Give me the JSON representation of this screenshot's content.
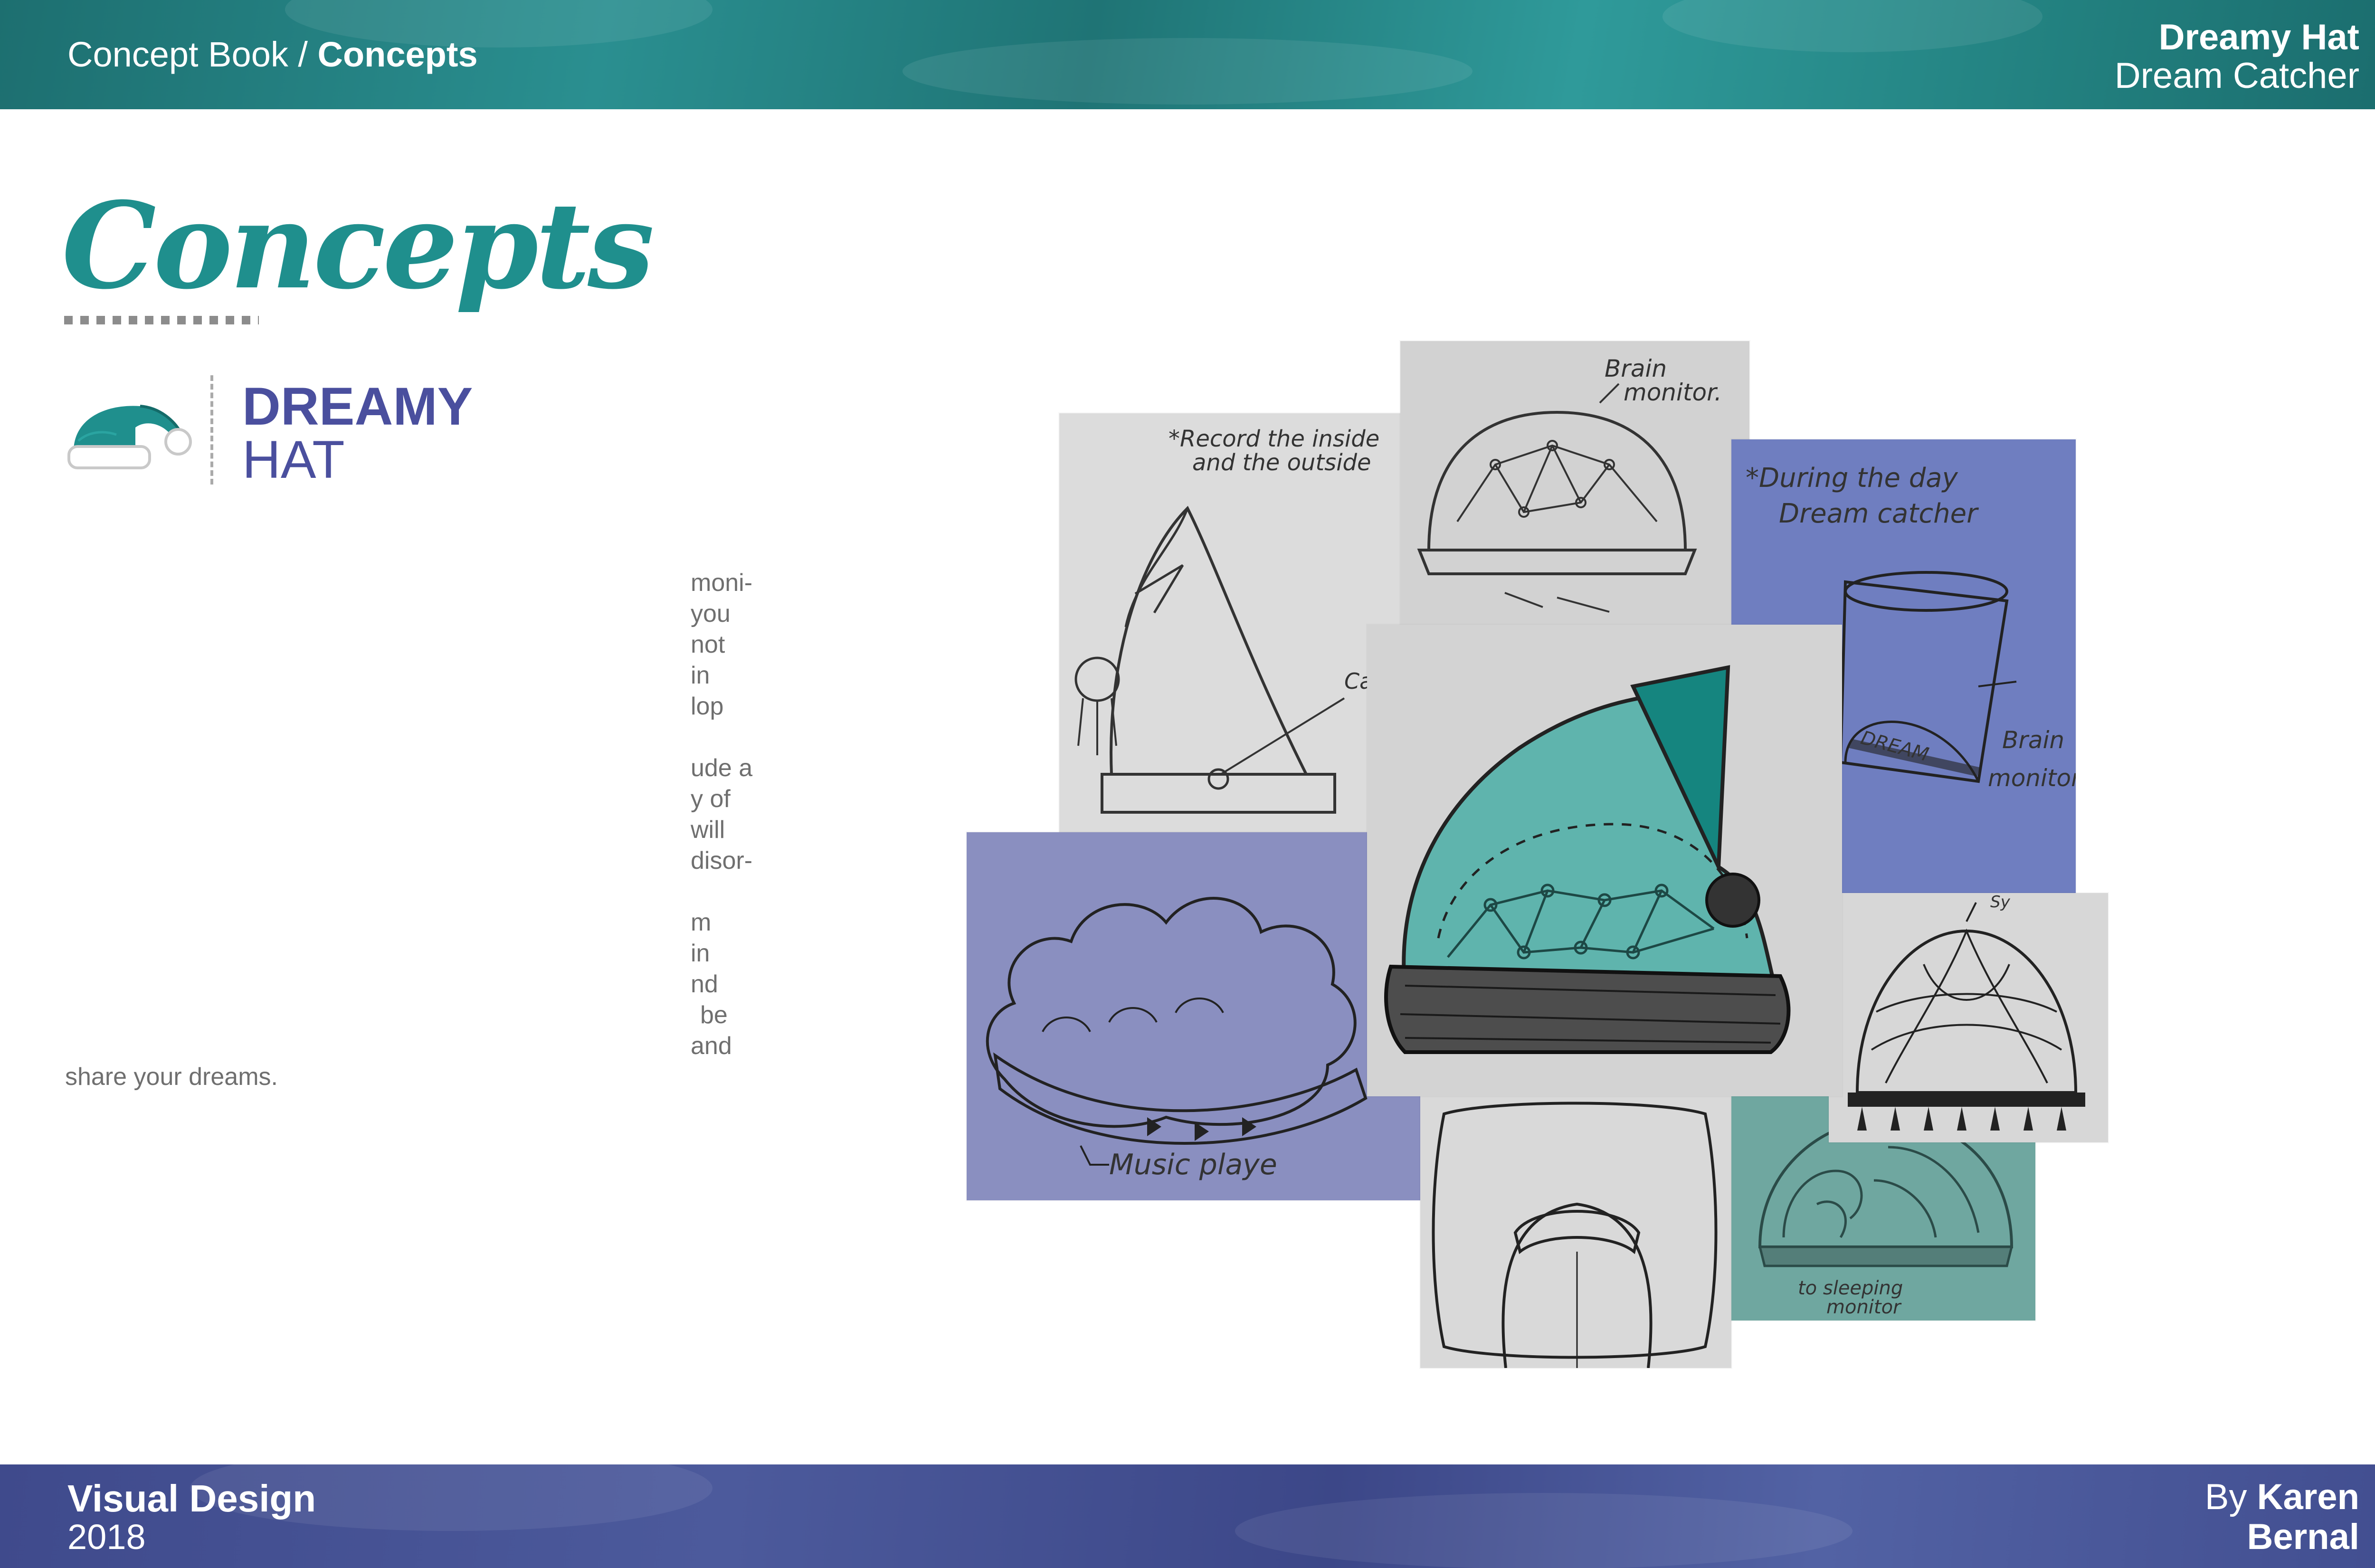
{
  "header": {
    "breadcrumb_prefix": "Concept Book / ",
    "breadcrumb_current": "Concepts",
    "project_title": "Dreamy Hat",
    "project_subtitle": "Dream Catcher"
  },
  "page": {
    "title": "Concepts",
    "brand_line1": "DREAMY",
    "brand_line2": "HAT"
  },
  "body": {
    "frag_1": "moni-",
    "frag_2": "you",
    "frag_3": "not",
    "frag_4": "in",
    "frag_5": "lop",
    "frag_6": "ude a",
    "frag_7": "y of",
    "frag_8": "will",
    "frag_9": "disor-",
    "frag_10": "m",
    "frag_11": "in",
    "frag_12": "nd",
    "frag_13": "be",
    "frag_14": "and",
    "last_line": "share your dreams."
  },
  "sketches": {
    "record_note_1": "*Record the inside",
    "record_note_2": "and the outside",
    "camera_label": "Ca",
    "brain_monitor_1": "Brain",
    "brain_monitor_2": "monitor.",
    "during_day_1": "*During the day",
    "during_day_2": "Dream catcher",
    "brain_label_1": "Brain",
    "brain_label_2": "monitor.",
    "dream_band": "DREAM",
    "music_player": "Music playe",
    "sleeping_monitor_1": "to sleeping",
    "sleeping_monitor_2": "monitor",
    "net_top_label": "Sy"
  },
  "footer": {
    "course": "Visual Design",
    "year": "2018",
    "by_prefix": "By ",
    "author_first": "Karen",
    "author_last": "Bernal"
  },
  "colors": {
    "teal": "#1f8f8d",
    "indigo": "#4a4f9e",
    "footer_blue": "#4c5a9c",
    "sketch_blue": "#6f7ec0",
    "sketch_purple": "#8a8fc0",
    "sketch_green": "#6fa7a0"
  }
}
